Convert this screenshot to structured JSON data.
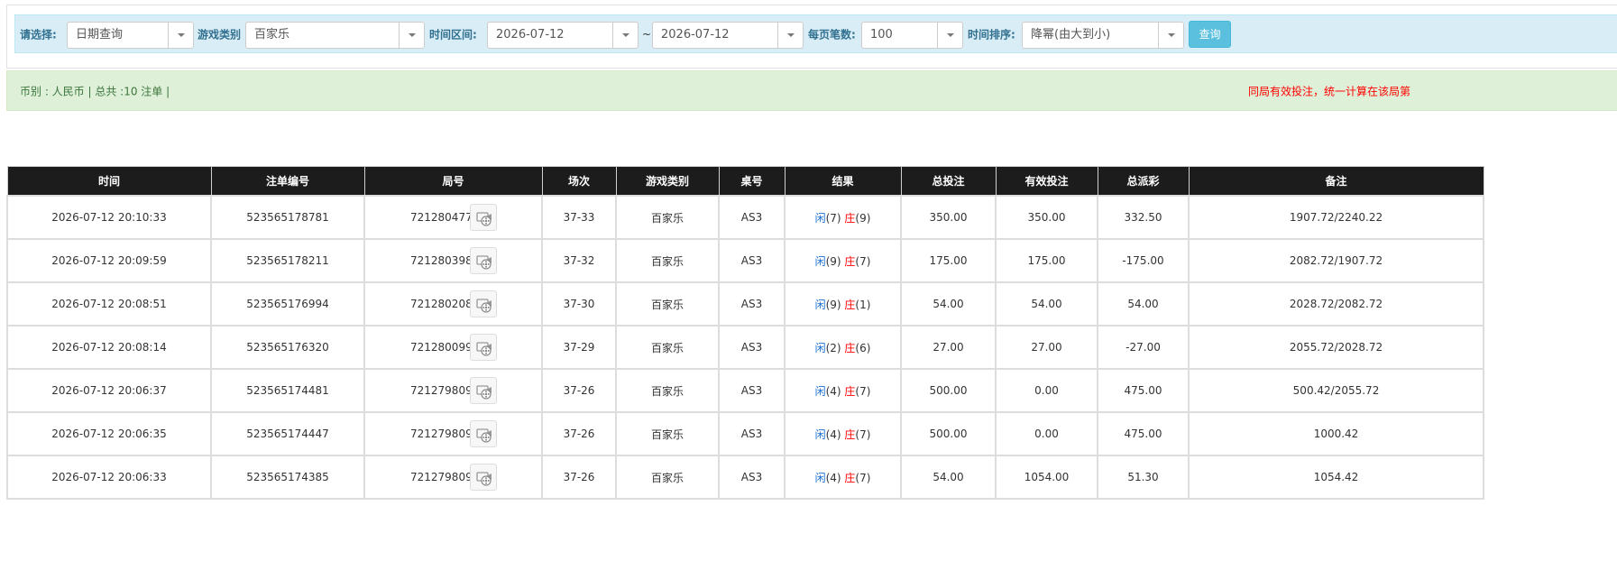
{
  "filters": {
    "select_label": "请选择:",
    "select_value": "日期查询",
    "game_type_label": "游戏类别",
    "game_type_value": "百家乐",
    "time_range_label": "时间区间:",
    "date_from": "2026-07-12",
    "range_separator": "~",
    "date_to": "2026-07-12",
    "per_page_label": "每页笔数:",
    "per_page_value": "100",
    "sort_label": "时间排序:",
    "sort_value": "降幂(由大到小)",
    "query_button": "查询"
  },
  "info": {
    "summary": "币别 : 人民币 | 总共 :10 注单 |",
    "notice": "同局有效投注，统一计算在该局第"
  },
  "colors": {
    "header_bg": "#1c1c1c",
    "filter_bg": "#d9edf7",
    "info_bg": "#dff0d8",
    "player_blue": "#1a6fd4",
    "banker_red": "#ff0000",
    "query_button": "#5bc0de"
  },
  "table": {
    "columns": [
      "时间",
      "注单编号",
      "局号",
      "场次",
      "游戏类别",
      "桌号",
      "结果",
      "总投注",
      "有效投注",
      "总派彩",
      "备注"
    ],
    "rows": [
      {
        "time": "2026-07-12 20:10:33",
        "bet_id": "523565178781",
        "round": "721280477",
        "session": "37-33",
        "game": "百家乐",
        "table": "AS3",
        "player": "闲",
        "player_score": "(7)",
        "banker": "庄",
        "banker_score": "(9)",
        "total_bet": "350.00",
        "valid_bet": "350.00",
        "payout": "332.50",
        "payout_negative": false,
        "remark": "1907.72/2240.22"
      },
      {
        "time": "2026-07-12 20:09:59",
        "bet_id": "523565178211",
        "round": "721280398",
        "session": "37-32",
        "game": "百家乐",
        "table": "AS3",
        "player": "闲",
        "player_score": "(9)",
        "banker": "庄",
        "banker_score": "(7)",
        "total_bet": "175.00",
        "valid_bet": "175.00",
        "payout": "-175.00",
        "payout_negative": true,
        "remark": "2082.72/1907.72"
      },
      {
        "time": "2026-07-12 20:08:51",
        "bet_id": "523565176994",
        "round": "721280208",
        "session": "37-30",
        "game": "百家乐",
        "table": "AS3",
        "player": "闲",
        "player_score": "(9)",
        "banker": "庄",
        "banker_score": "(1)",
        "total_bet": "54.00",
        "valid_bet": "54.00",
        "payout": "54.00",
        "payout_negative": false,
        "remark": "2028.72/2082.72"
      },
      {
        "time": "2026-07-12 20:08:14",
        "bet_id": "523565176320",
        "round": "721280099",
        "session": "37-29",
        "game": "百家乐",
        "table": "AS3",
        "player": "闲",
        "player_score": "(2)",
        "banker": "庄",
        "banker_score": "(6)",
        "total_bet": "27.00",
        "valid_bet": "27.00",
        "payout": "-27.00",
        "payout_negative": true,
        "remark": "2055.72/2028.72"
      },
      {
        "time": "2026-07-12 20:06:37",
        "bet_id": "523565174481",
        "round": "721279809",
        "session": "37-26",
        "game": "百家乐",
        "table": "AS3",
        "player": "闲",
        "player_score": "(4)",
        "banker": "庄",
        "banker_score": "(7)",
        "total_bet": "500.00",
        "valid_bet": "0.00",
        "payout": "475.00",
        "payout_negative": false,
        "remark": "500.42/2055.72"
      },
      {
        "time": "2026-07-12 20:06:35",
        "bet_id": "523565174447",
        "round": "721279809",
        "session": "37-26",
        "game": "百家乐",
        "table": "AS3",
        "player": "闲",
        "player_score": "(4)",
        "banker": "庄",
        "banker_score": "(7)",
        "total_bet": "500.00",
        "valid_bet": "0.00",
        "payout": "475.00",
        "payout_negative": false,
        "remark": "1000.42"
      },
      {
        "time": "2026-07-12 20:06:33",
        "bet_id": "523565174385",
        "round": "721279809",
        "session": "37-26",
        "game": "百家乐",
        "table": "AS3",
        "player": "闲",
        "player_score": "(4)",
        "banker": "庄",
        "banker_score": "(7)",
        "total_bet": "54.00",
        "valid_bet": "1054.00",
        "payout": "51.30",
        "payout_negative": false,
        "remark": "1054.42"
      }
    ]
  }
}
